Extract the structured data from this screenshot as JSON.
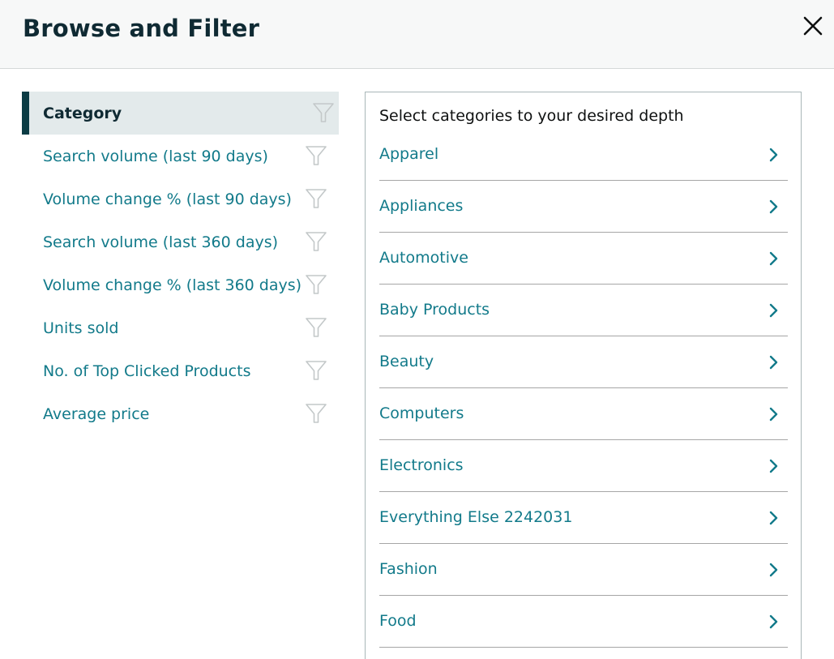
{
  "header": {
    "title": "Browse and Filter",
    "close_icon": "close-icon"
  },
  "filters": [
    {
      "label": "Category",
      "active": true
    },
    {
      "label": "Search volume (last 90 days)",
      "active": false
    },
    {
      "label": "Volume change % (last 90 days)",
      "active": false
    },
    {
      "label": "Search volume (last 360 days)",
      "active": false
    },
    {
      "label": "Volume change % (last 360 days)",
      "active": false
    },
    {
      "label": "Units sold",
      "active": false
    },
    {
      "label": "No. of Top Clicked Products",
      "active": false
    },
    {
      "label": "Average price",
      "active": false
    }
  ],
  "panel": {
    "heading": "Select categories to your desired depth",
    "categories": [
      "Apparel",
      "Appliances",
      "Automotive",
      "Baby Products",
      "Beauty",
      "Computers",
      "Electronics",
      "Everything Else 2242031",
      "Fashion",
      "Food"
    ]
  },
  "colors": {
    "link": "#127a8a",
    "active_bar": "#0b3c44",
    "active_bg": "#e3eaeb",
    "title": "#0f2a33"
  }
}
